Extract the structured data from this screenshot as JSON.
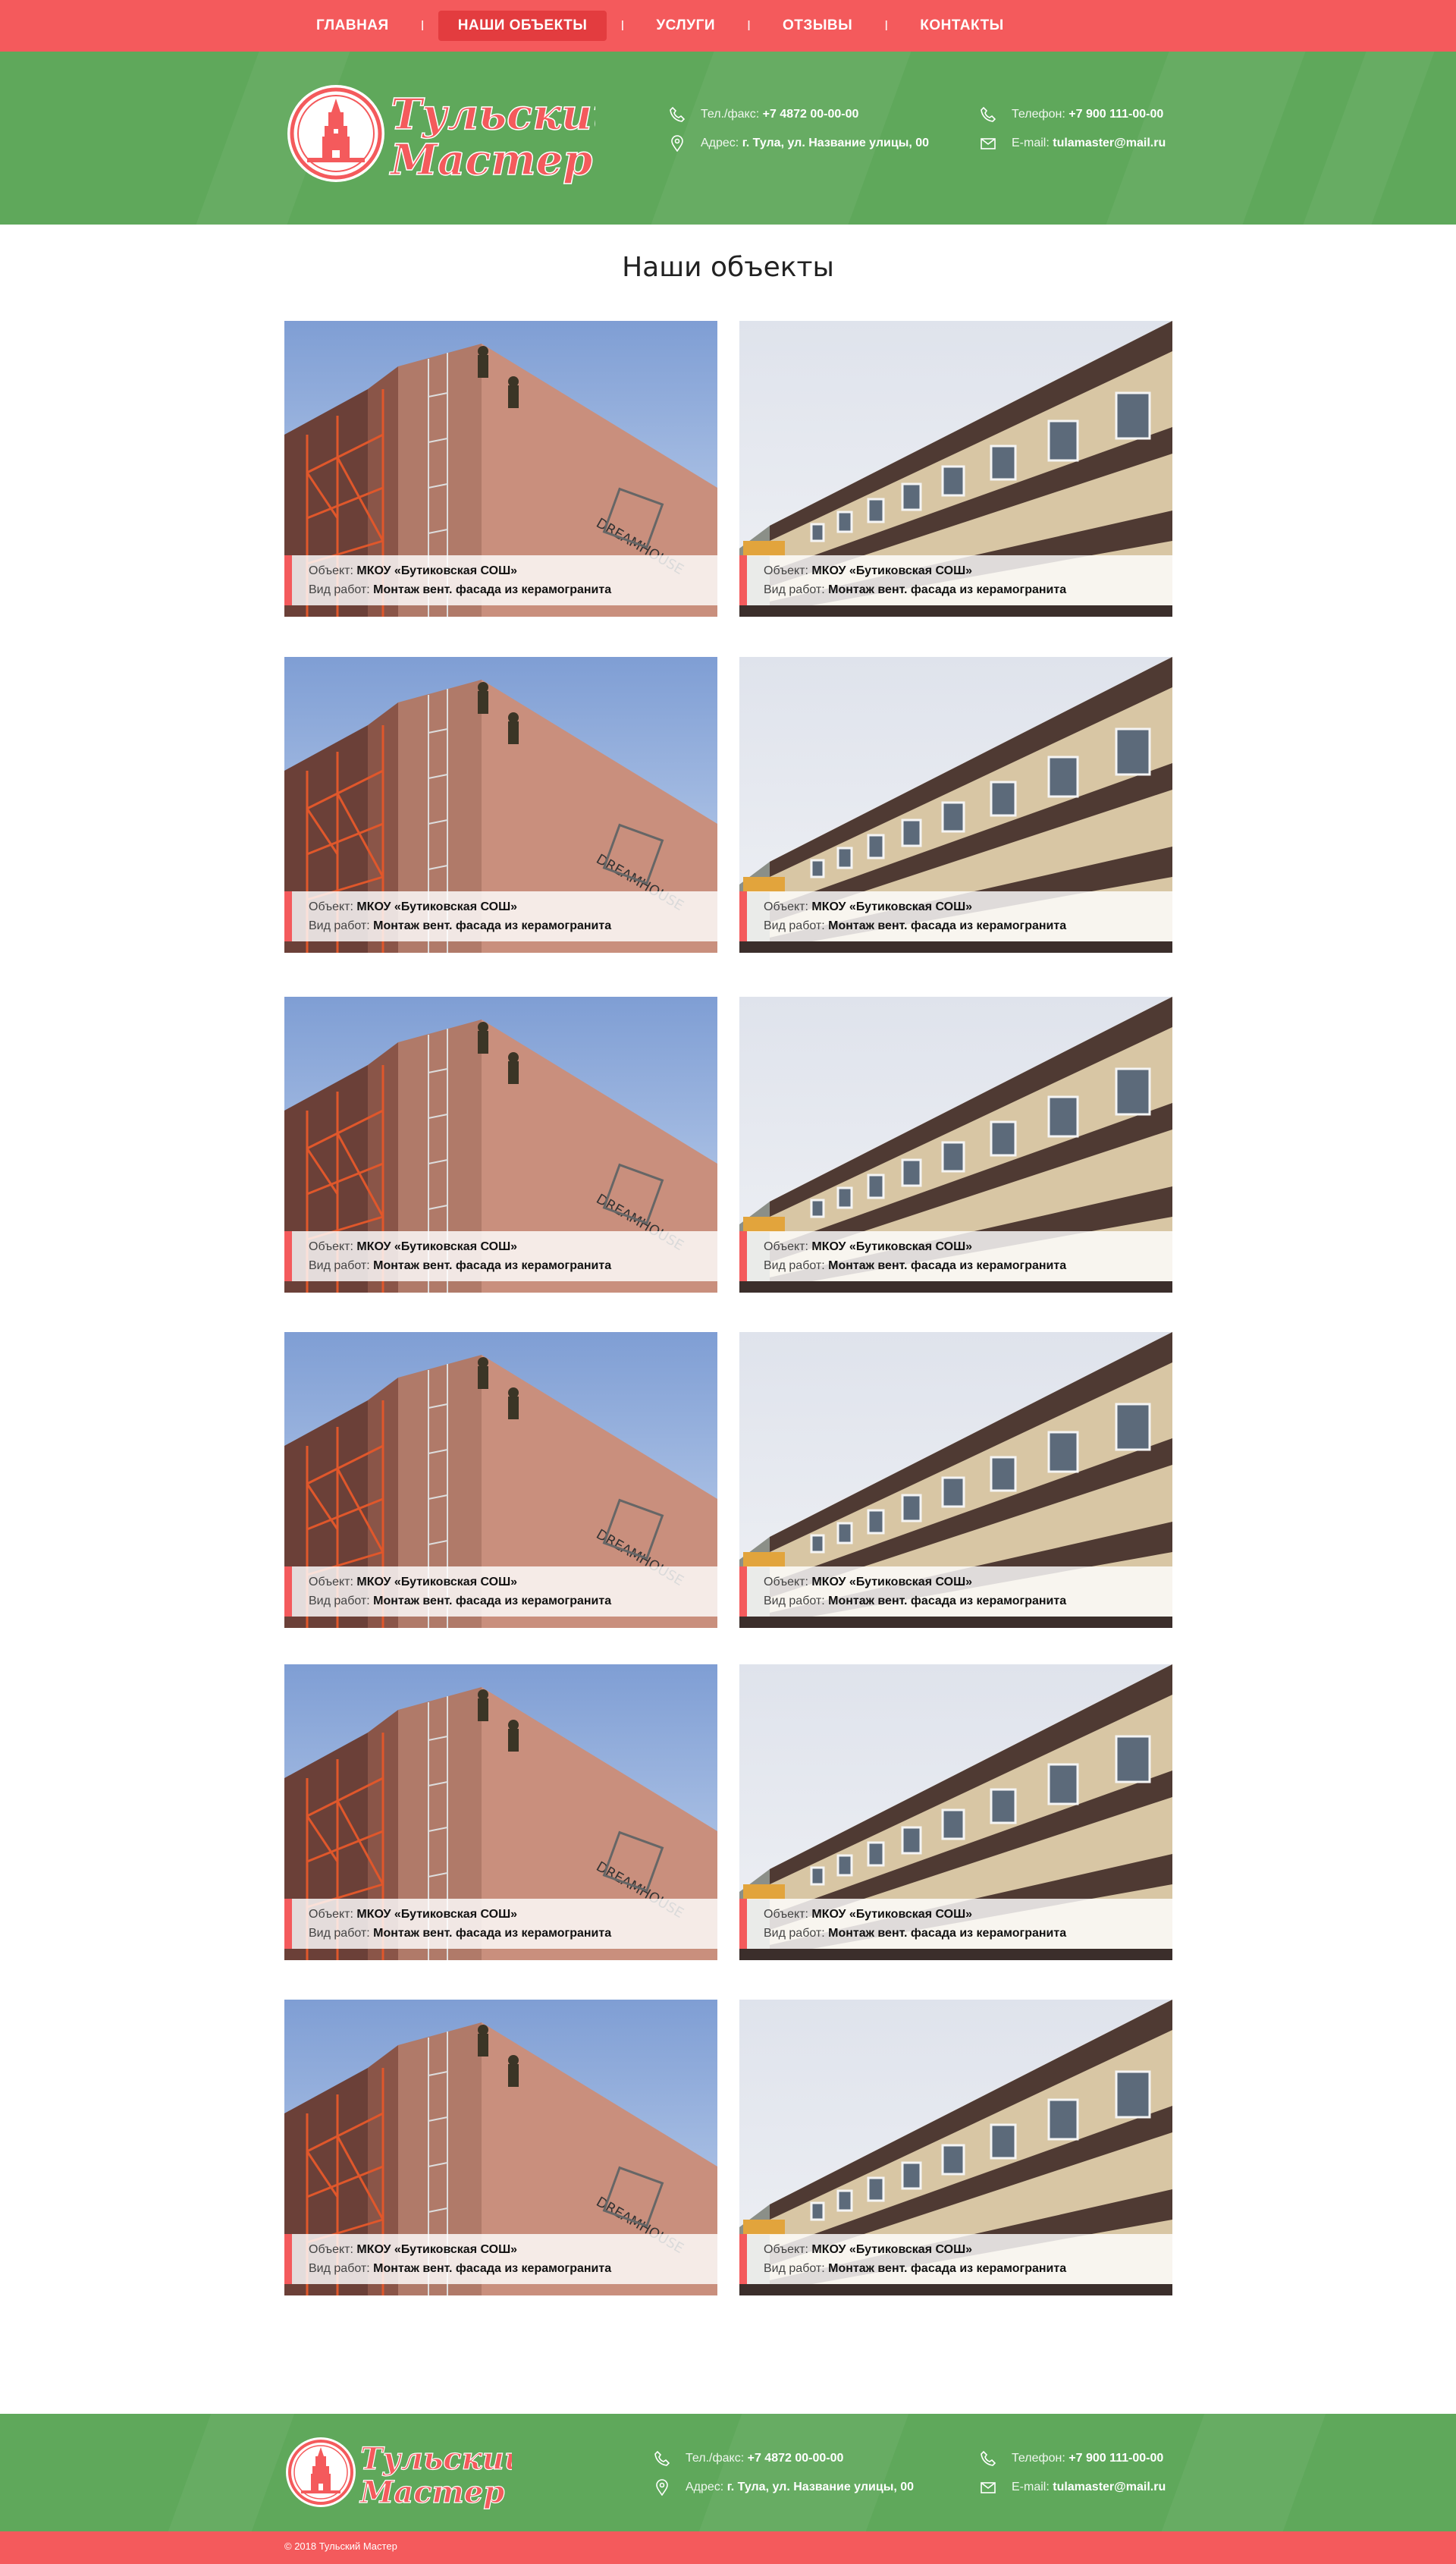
{
  "nav": {
    "items": [
      {
        "label": "ГЛАВНАЯ"
      },
      {
        "label": "НАШИ ОБЪЕКТЫ"
      },
      {
        "label": "УСЛУГИ"
      },
      {
        "label": "ОТЗЫВЫ"
      },
      {
        "label": "КОНТАКТЫ"
      }
    ],
    "active_index": 1,
    "separator": "I"
  },
  "brand": {
    "line1": "Тульский",
    "line2": "Мастер",
    "color": "#f45a5c"
  },
  "header": {
    "phone_fax_label": "Тел./факс:",
    "phone_fax": "+7 4872 00-00-00",
    "address_label": "Адрес:",
    "address": "г. Тула, ул. Название улицы, 00",
    "phone_label": "Телефон:",
    "phone": "+7 900 111-00-00",
    "email_label": "E-mail:",
    "email": "tulamaster@mail.ru"
  },
  "main": {
    "title": "Наши объекты",
    "objects": [
      {
        "object_label": "Объект:",
        "object": "МКОУ «Бутиковская СОШ»",
        "work_label": "Вид работ:",
        "work": "Монтаж вент. фасада из керамогранита",
        "photo": "tower-climbers"
      },
      {
        "object_label": "Объект:",
        "object": "МКОУ «Бутиковская СОШ»",
        "work_label": "Вид работ:",
        "work": "Монтаж вент. фасада из керамогранита",
        "photo": "long-facade"
      },
      {
        "object_label": "Объект:",
        "object": "МКОУ «Бутиковская СОШ»",
        "work_label": "Вид работ:",
        "work": "Монтаж вент. фасада из керамогранита",
        "photo": "tower-climbers"
      },
      {
        "object_label": "Объект:",
        "object": "МКОУ «Бутиковская СОШ»",
        "work_label": "Вид работ:",
        "work": "Монтаж вент. фасада из керамогранита",
        "photo": "long-facade"
      },
      {
        "object_label": "Объект:",
        "object": "МКОУ «Бутиковская СОШ»",
        "work_label": "Вид работ:",
        "work": "Монтаж вент. фасада из керамогранита",
        "photo": "tower-climbers"
      },
      {
        "object_label": "Объект:",
        "object": "МКОУ «Бутиковская СОШ»",
        "work_label": "Вид работ:",
        "work": "Монтаж вент. фасада из керамогранита",
        "photo": "long-facade"
      },
      {
        "object_label": "Объект:",
        "object": "МКОУ «Бутиковская СОШ»",
        "work_label": "Вид работ:",
        "work": "Монтаж вент. фасада из керамогранита",
        "photo": "tower-climbers"
      },
      {
        "object_label": "Объект:",
        "object": "МКОУ «Бутиковская СОШ»",
        "work_label": "Вид работ:",
        "work": "Монтаж вент. фасада из керамогранита",
        "photo": "long-facade"
      },
      {
        "object_label": "Объект:",
        "object": "МКОУ «Бутиковская СОШ»",
        "work_label": "Вид работ:",
        "work": "Монтаж вент. фасада из керамогранита",
        "photo": "tower-climbers"
      },
      {
        "object_label": "Объект:",
        "object": "МКОУ «Бутиковская СОШ»",
        "work_label": "Вид работ:",
        "work": "Монтаж вент. фасада из керамогранита",
        "photo": "long-facade"
      },
      {
        "object_label": "Объект:",
        "object": "МКОУ «Бутиковская СОШ»",
        "work_label": "Вид работ:",
        "work": "Монтаж вент. фасада из керамогранита",
        "photo": "tower-climbers"
      },
      {
        "object_label": "Объект:",
        "object": "МКОУ «Бутиковская СОШ»",
        "work_label": "Вид работ:",
        "work": "Монтаж вент. фасада из керамогранита",
        "photo": "long-facade"
      }
    ]
  },
  "footer": {
    "phone_fax_label": "Тел./факс:",
    "phone_fax": "+7 4872 00-00-00",
    "address_label": "Адрес:",
    "address": "г. Тула, ул. Название улицы, 00",
    "phone_label": "Телефон:",
    "phone": "+7 900 111-00-00",
    "email_label": "E-mail:",
    "email": "tulamaster@mail.ru",
    "copyright": "© 2018  Тульский Мастер"
  },
  "colors": {
    "red": "#f45a5c",
    "green": "#5fa85b"
  },
  "icons": [
    "phone-icon",
    "location-pin-icon",
    "mail-icon",
    "kremlin-tower-icon"
  ]
}
